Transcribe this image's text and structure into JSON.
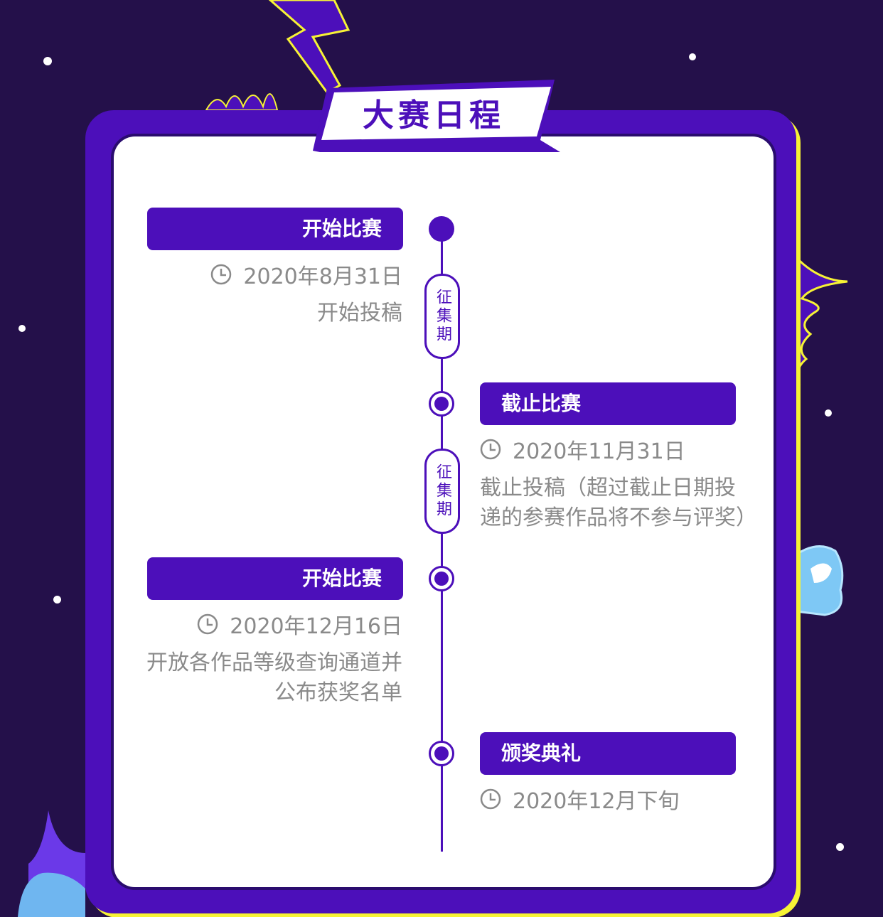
{
  "colors": {
    "background": "#24104a",
    "frame": "#4c0fba",
    "frame_highlight": "#f7f335",
    "card": "#ffffff",
    "text_muted": "#8a8a8a"
  },
  "title": "大赛日程",
  "period_label": "征集期",
  "events": [
    {
      "label": "开始比赛",
      "date": "2020年8月31日",
      "desc": [
        "开始投稿"
      ],
      "side": "left",
      "icon": "clock-icon"
    },
    {
      "label": "截止比赛",
      "date": "2020年11月31日",
      "desc": [
        "截止投稿（超过截止日期投",
        "递的参赛作品将不参与评奖）"
      ],
      "side": "right",
      "icon": "clock-icon"
    },
    {
      "label": "开始比赛",
      "date": "2020年12月16日",
      "desc": [
        "开放各作品等级查询通道并",
        "公布获奖名单"
      ],
      "side": "left",
      "icon": "clock-icon"
    },
    {
      "label": "颁奖典礼",
      "date": "2020年12月下旬",
      "desc": [],
      "side": "right",
      "icon": "clock-icon"
    }
  ]
}
